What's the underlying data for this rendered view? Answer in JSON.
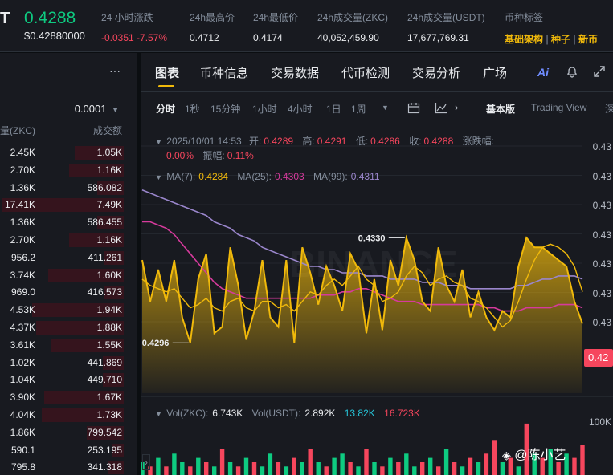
{
  "ticker": {
    "pair_tail": "T",
    "price": "0.4288",
    "price_usd": "$0.42880000",
    "stats": [
      {
        "label": "24 小时涨跌",
        "value": "-0.0351 -7.57%",
        "color": "#f6465d"
      },
      {
        "label": "24h最高价",
        "value": "0.4712",
        "color": "#eaecef"
      },
      {
        "label": "24h最低价",
        "value": "0.4174",
        "color": "#eaecef"
      },
      {
        "label": "24h成交量(ZKC)",
        "value": "40,052,459.90",
        "color": "#eaecef"
      },
      {
        "label": "24h成交量(USDT)",
        "value": "17,677,769.31",
        "color": "#eaecef"
      }
    ],
    "tags_label": "币种标签",
    "tags": [
      "基础架构",
      "种子",
      "新币"
    ],
    "tag_color": "#f0b90b"
  },
  "orderbook": {
    "more": "···",
    "precision": "0.0001",
    "col_qty": "量(ZKC)",
    "col_total": "成交额",
    "rows": [
      {
        "qty": "2.45K",
        "total": "1.05K",
        "depth": 0.4
      },
      {
        "qty": "2.70K",
        "total": "1.16K",
        "depth": 0.45
      },
      {
        "qty": "1.36K",
        "total": "586.082",
        "depth": 0.22
      },
      {
        "qty": "17.41K",
        "total": "7.49K",
        "depth": 1.0
      },
      {
        "qty": "1.36K",
        "total": "586.455",
        "depth": 0.22
      },
      {
        "qty": "2.70K",
        "total": "1.16K",
        "depth": 0.45
      },
      {
        "qty": "956.2",
        "total": "411.261",
        "depth": 0.16
      },
      {
        "qty": "3.74K",
        "total": "1.60K",
        "depth": 0.62
      },
      {
        "qty": "969.0",
        "total": "416.573",
        "depth": 0.16
      },
      {
        "qty": "4.53K",
        "total": "1.94K",
        "depth": 0.75
      },
      {
        "qty": "4.37K",
        "total": "1.88K",
        "depth": 0.72
      },
      {
        "qty": "3.61K",
        "total": "1.55K",
        "depth": 0.6
      },
      {
        "qty": "1.02K",
        "total": "441.869",
        "depth": 0.17
      },
      {
        "qty": "1.04K",
        "total": "449.710",
        "depth": 0.17
      },
      {
        "qty": "3.90K",
        "total": "1.67K",
        "depth": 0.65
      },
      {
        "qty": "4.04K",
        "total": "1.73K",
        "depth": 0.67
      },
      {
        "qty": "1.86K",
        "total": "799.542",
        "depth": 0.3
      },
      {
        "qty": "590.1",
        "total": "253.195",
        "depth": 0.1
      },
      {
        "qty": "795.8",
        "total": "341.318",
        "depth": 0.13
      }
    ]
  },
  "tabs": [
    "图表",
    "币种信息",
    "交易数据",
    "代币检测",
    "交易分析",
    "广场"
  ],
  "intervals": [
    "分时",
    "1秒",
    "15分钟",
    "1小时",
    "4小时",
    "1日",
    "1周"
  ],
  "view_modes": [
    "基本版",
    "Trading View",
    "深"
  ],
  "ai_label": "Ai",
  "ohlc": {
    "date": "2025/10/01 14:53",
    "open_label": "开:",
    "open": "0.4289",
    "high_label": "高:",
    "high": "0.4291",
    "low_label": "低:",
    "low": "0.4286",
    "close_label": "收:",
    "close": "0.4288",
    "change_label": "涨跌幅:",
    "change": "0.00%",
    "amp_label": "振幅:",
    "amp": "0.11%"
  },
  "ma": {
    "ma7_label": "MA(7):",
    "ma7": "0.4284",
    "ma25_label": "MA(25):",
    "ma25": "0.4303",
    "ma99_label": "MA(99):",
    "ma99": "0.4311"
  },
  "vol": {
    "label_zkc": "Vol(ZKC):",
    "zkc": "6.743K",
    "label_usdt": "Vol(USDT):",
    "usdt": "2.892K",
    "v1": "13.82K",
    "v2": "16.723K",
    "axis": "100K"
  },
  "markers": {
    "high": "0.4330",
    "low": "0.4296"
  },
  "y_axis_labels": [
    "0.43",
    "0.43",
    "0.43",
    "0.43",
    "0.43",
    "0.43",
    "0.43"
  ],
  "current_price_tag": "0.42",
  "colors": {
    "price": "#f0b90b",
    "ma7": "#f0b90b",
    "ma25": "#d63a9c",
    "ma99": "#9a86cc",
    "up": "#0ecb81",
    "down": "#f6465d"
  },
  "watermark": "BINANCE",
  "chart_data": {
    "type": "area",
    "title": "",
    "xlabel": "",
    "ylabel": "",
    "ylim": [
      0.4285,
      0.4345
    ],
    "series": [
      {
        "values": [
          0.4318,
          0.4305,
          0.4315,
          0.4305,
          0.4318,
          0.43,
          0.4292,
          0.4312,
          0.432,
          0.4295,
          0.4297,
          0.4322,
          0.431,
          0.4293,
          0.4302,
          0.4318,
          0.43,
          0.4297,
          0.4318,
          0.4292,
          0.4322,
          0.4314,
          0.4304,
          0.4316,
          0.431,
          0.4302,
          0.432,
          0.4315,
          0.4295,
          0.4312,
          0.4296,
          0.4318,
          0.431,
          0.4325,
          0.4318,
          0.4305,
          0.4302,
          0.4322,
          0.431,
          0.4305,
          0.4315,
          0.43,
          0.4308,
          0.43,
          0.4296,
          0.4302,
          0.43,
          0.4316,
          0.4325,
          0.4322,
          0.4322,
          0.432,
          0.4318,
          0.4316,
          0.4305,
          0.4298
        ]
      },
      {
        "name": "MA(7)",
        "values": [
          0.4312,
          0.431,
          0.4309,
          0.4308,
          0.4309,
          0.4306,
          0.4303,
          0.4304,
          0.4306,
          0.4303,
          0.4302,
          0.4305,
          0.4306,
          0.4303,
          0.4302,
          0.4305,
          0.4305,
          0.4303,
          0.4304,
          0.4302,
          0.4305,
          0.4308,
          0.4307,
          0.431,
          0.4312,
          0.431,
          0.4313,
          0.4316,
          0.4312,
          0.431,
          0.4305,
          0.4306,
          0.4308,
          0.4313,
          0.4316,
          0.4314,
          0.431,
          0.4312,
          0.4313,
          0.4311,
          0.431,
          0.4306,
          0.4305,
          0.4303,
          0.43,
          0.4297,
          0.4299,
          0.4305,
          0.4312,
          0.4318,
          0.4322,
          0.4323,
          0.4322,
          0.432,
          0.4316,
          0.4308
        ]
      },
      {
        "name": "MA(25)",
        "values": [
          0.433,
          0.433,
          0.4329,
          0.4328,
          0.4326,
          0.4323,
          0.432,
          0.4317,
          0.4314,
          0.4311,
          0.4309,
          0.4308,
          0.4307,
          0.4306,
          0.4306,
          0.4306,
          0.4306,
          0.4306,
          0.4306,
          0.4306,
          0.4306,
          0.4306,
          0.4307,
          0.4307,
          0.4307,
          0.4308,
          0.4308,
          0.4309,
          0.4309,
          0.4308,
          0.4307,
          0.4306,
          0.4305,
          0.4305,
          0.4305,
          0.4304,
          0.4304,
          0.4304,
          0.4304,
          0.4304,
          0.4304,
          0.4304,
          0.4304,
          0.4303,
          0.4303,
          0.4302,
          0.4302,
          0.4302,
          0.4303,
          0.4303,
          0.4303,
          0.4303,
          0.4304,
          0.4304,
          0.4304,
          0.4303
        ]
      },
      {
        "name": "MA(99)",
        "values": [
          0.434,
          0.4339,
          0.4338,
          0.4337,
          0.4336,
          0.4335,
          0.4334,
          0.4333,
          0.4332,
          0.433,
          0.4329,
          0.4328,
          0.4326,
          0.4325,
          0.4324,
          0.4322,
          0.4321,
          0.432,
          0.4319,
          0.4318,
          0.4317,
          0.4316,
          0.4316,
          0.4315,
          0.4315,
          0.4314,
          0.4314,
          0.4314,
          0.4313,
          0.4313,
          0.4313,
          0.4312,
          0.4312,
          0.4312,
          0.4312,
          0.4311,
          0.4311,
          0.4311,
          0.431,
          0.431,
          0.431,
          0.4309,
          0.4309,
          0.4309,
          0.4309,
          0.4309,
          0.4309,
          0.431,
          0.431,
          0.4311,
          0.4312,
          0.4312,
          0.4313,
          0.4313,
          0.4313,
          0.4312
        ]
      }
    ],
    "volume": [
      3,
      2,
      4,
      2,
      5,
      3,
      2,
      4,
      3,
      2,
      6,
      3,
      2,
      4,
      3,
      2,
      5,
      3,
      2,
      4,
      3,
      6,
      3,
      2,
      4,
      5,
      3,
      2,
      6,
      3,
      2,
      4,
      3,
      5,
      2,
      3,
      4,
      2,
      6,
      3,
      2,
      4,
      3,
      5,
      8,
      3,
      4,
      2,
      12,
      5,
      4,
      6,
      3,
      5,
      4,
      7
    ],
    "volume_up": [
      true,
      false,
      true,
      false,
      true,
      true,
      false,
      true,
      false,
      true,
      false,
      true,
      false,
      true,
      false,
      true,
      true,
      false,
      true,
      false,
      true,
      false,
      true,
      false,
      true,
      true,
      false,
      true,
      false,
      true,
      false,
      true,
      false,
      true,
      true,
      false,
      true,
      false,
      true,
      false,
      true,
      false,
      true,
      false,
      false,
      true,
      false,
      true,
      false,
      true,
      false,
      true,
      false,
      true,
      false,
      false
    ],
    "volume_ylim": [
      0,
      100
    ]
  }
}
